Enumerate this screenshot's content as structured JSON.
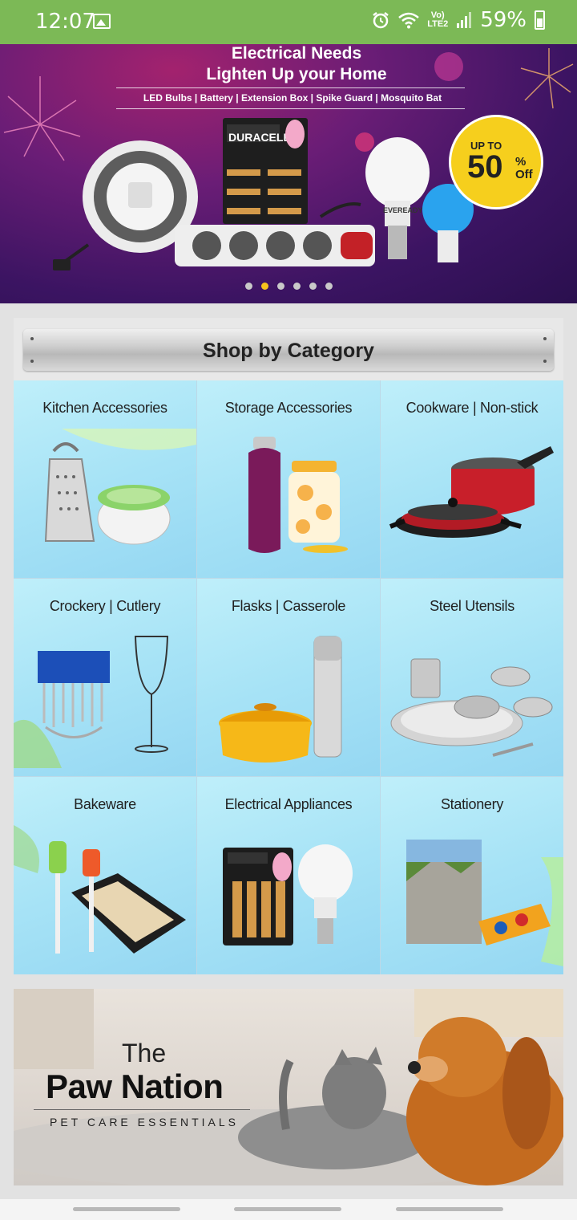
{
  "status_bar": {
    "time": "12:07",
    "battery": "59%",
    "network": "Vo) LTE2",
    "icons": [
      "gallery-icon",
      "alarm-icon",
      "wifi-icon",
      "signal-icon",
      "battery-icon"
    ]
  },
  "hero": {
    "title_line1": "Electrical Needs",
    "title_line2": "Lighten Up your Home",
    "subtitle": "LED Bulbs | Battery | Extension Box | Spike Guard | Mosquito Bat",
    "offer_up_to": "UP TO",
    "offer_value": "50",
    "offer_percent": "%",
    "offer_off": "Off",
    "brand_battery": "DURACELL",
    "brand_bulb": "EVEREADY",
    "slide_count": 6,
    "active_slide": 2
  },
  "category": {
    "header": "Shop by Category",
    "items": [
      {
        "label": "Kitchen Accessories"
      },
      {
        "label": "Storage Accessories"
      },
      {
        "label": "Cookware | Non-stick"
      },
      {
        "label": "Crockery | Cutlery"
      },
      {
        "label": "Flasks | Casserole"
      },
      {
        "label": "Steel Utensils"
      },
      {
        "label": "Bakeware"
      },
      {
        "label": "Electrical Appliances"
      },
      {
        "label": "Stationery"
      }
    ]
  },
  "pet_banner": {
    "the": "The",
    "title": "Paw Nation",
    "subtitle": "PET CARE ESSENTIALS"
  },
  "colors": {
    "status_bar": "#7cb956",
    "tile_bg": "#a7e3f6",
    "offer_badge": "#f6cf1d"
  }
}
